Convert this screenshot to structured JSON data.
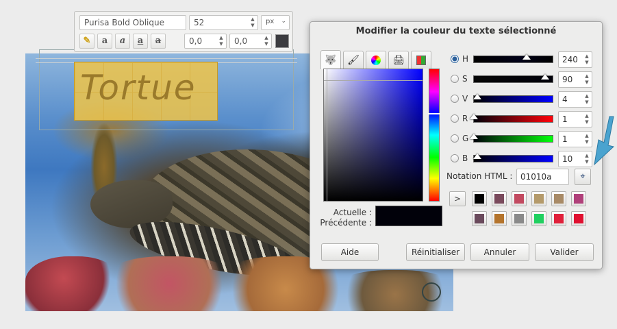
{
  "toolbar": {
    "font_name": "Purisa Bold Oblique",
    "font_size": "52",
    "unit": "px",
    "baseline_offset": "0,0",
    "kerning_offset": "0,0",
    "text_color": "#3c3c40"
  },
  "canvas": {
    "text": "Tortue"
  },
  "dialog": {
    "title": "Modifier la couleur du texte sélectionné",
    "current_label": "Actuelle :",
    "previous_label": "Précédente :",
    "current_color": "#01010a",
    "channels": [
      {
        "letter": "H",
        "value": "240",
        "level": 0.67,
        "selected": true
      },
      {
        "letter": "S",
        "value": "90",
        "level": 0.9,
        "selected": false
      },
      {
        "letter": "V",
        "value": "4",
        "level": 0.04,
        "selected": false
      },
      {
        "letter": "R",
        "value": "1",
        "level": 0.004,
        "selected": false
      },
      {
        "letter": "G",
        "value": "1",
        "level": 0.004,
        "selected": false
      },
      {
        "letter": "B",
        "value": "10",
        "level": 0.04,
        "selected": false
      }
    ],
    "html_label": "Notation HTML :",
    "html_value": "01010a",
    "history_toggle": ">",
    "history_colors": [
      "#000000",
      "#7a4a5c",
      "#c24a60",
      "#b49a6a",
      "#a88a66",
      "#b0407a",
      "#6a4a5c",
      "#b4742c",
      "#8a8a8a",
      "#20d060",
      "#e0203a",
      "#e01030"
    ],
    "buttons": {
      "help": "Aide",
      "reset": "Réinitialiser",
      "cancel": "Annuler",
      "ok": "Valider"
    }
  }
}
